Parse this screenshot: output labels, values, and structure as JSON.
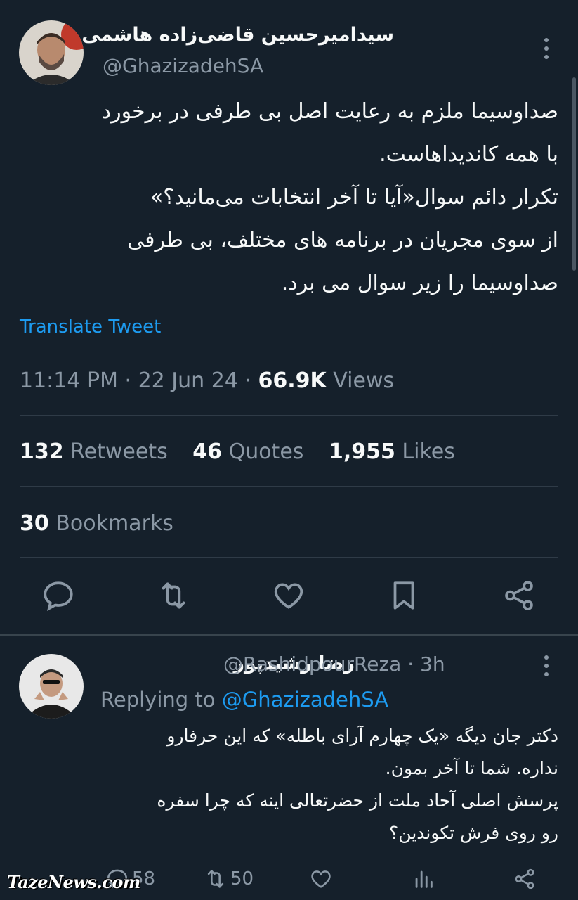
{
  "tweet": {
    "author_name": "سیدامیرحسین قاضی‌زاده هاشمی",
    "handle": "@GhazizadehSA",
    "text_lines": [
      "صداوسیما ملزم به رعایت اصل بی طرفی در برخورد",
      "با همه کاندیداهاست.",
      "تکرار دائم سوال«آیا تا آخر انتخابات می‌مانید؟»",
      "از سوی مجریان در برنامه های مختلف، بی طرفی",
      "صداوسیما را زیر سوال می برد."
    ],
    "translate_label": "Translate Tweet",
    "time": "11:14 PM · 22 Jun 24 · ",
    "views_count": "66.9K",
    "views_label": " Views",
    "stats": {
      "retweets_count": "132",
      "retweets_label": "Retweets",
      "quotes_count": "46",
      "quotes_label": "Quotes",
      "likes_count": "1,955",
      "likes_label": "Likes",
      "bookmarks_count": "30",
      "bookmarks_label": "Bookmarks"
    },
    "actions": [
      "reply-icon",
      "retweet-icon",
      "like-icon",
      "bookmark-icon",
      "share-icon"
    ]
  },
  "reply": {
    "author_name": "رضا رشیدپور",
    "handle_time": "@RashidpourReza · 3h",
    "replying_prefix": "Replying to ",
    "replying_handle": "@GhazizadehSA",
    "text_lines": [
      "دکتر جان دیگه «یک چهارم آرای باطله» که این حرفارو",
      "نداره. شما تا آخر بمون.",
      "پرسش اصلی آحاد ملت از حضرتعالی اینه که چرا سفره",
      "رو روی فرش تکوندین؟"
    ],
    "reply_count": "58",
    "retweet_count": "50"
  },
  "watermark": "TazeNews.com",
  "colors": {
    "background": "#15202b",
    "accent": "#1d9bf0",
    "muted": "#8b98a5",
    "text": "#f7f9f9"
  }
}
